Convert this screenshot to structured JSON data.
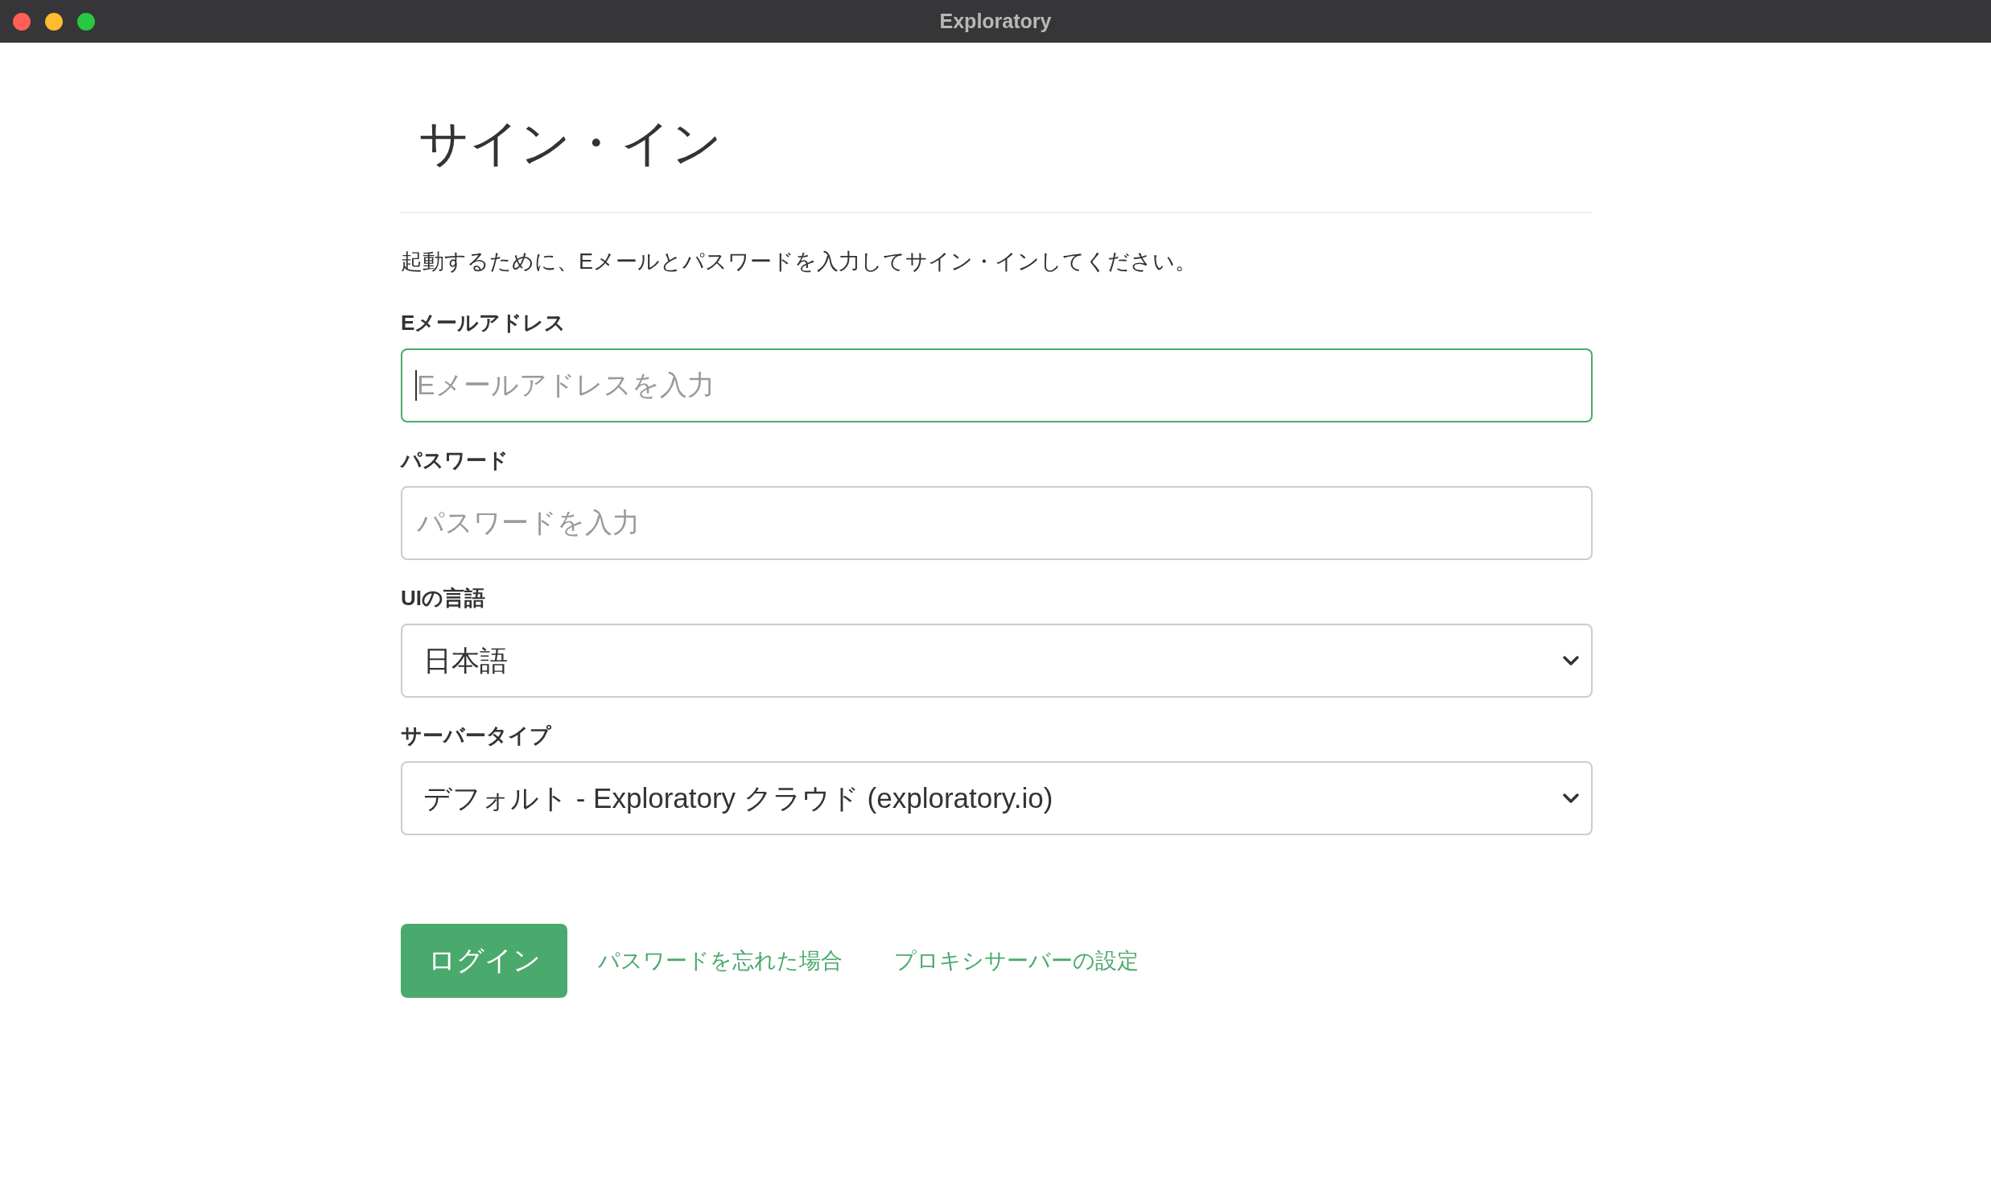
{
  "window": {
    "title": "Exploratory"
  },
  "heading": "サイン・イン",
  "description": "起動するために、Eメールとパスワードを入力してサイン・インしてください。",
  "fields": [
    {
      "kind": "input",
      "label": "Eメールアドレス",
      "placeholder": "Eメールアドレスを入力",
      "focused": true
    },
    {
      "kind": "input",
      "label": "パスワード",
      "placeholder": "パスワードを入力",
      "focused": false
    },
    {
      "kind": "select",
      "label": "UIの言語",
      "value": "日本語",
      "focused": false
    },
    {
      "kind": "select",
      "label": "サーバータイプ",
      "value": "デフォルト - Exploratory クラウド (exploratory.io)",
      "focused": false
    }
  ],
  "login_button": "ログイン",
  "links": [
    "パスワードを忘れた場合",
    "プロキシサーバーの設定"
  ]
}
